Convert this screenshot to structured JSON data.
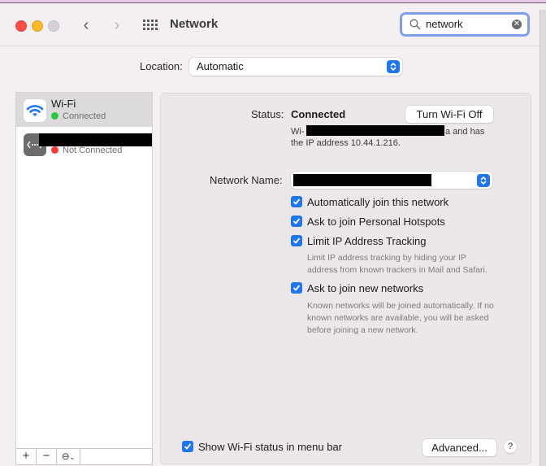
{
  "window": {
    "title": "Network",
    "search": {
      "value": "network",
      "placeholder": "Search"
    }
  },
  "location": {
    "label": "Location:",
    "value": "Automatic"
  },
  "sidebar": {
    "services": [
      {
        "name": "Wi-Fi",
        "status": "Connected",
        "status_color": "#27c93f",
        "icon": "wifi-icon",
        "selected": true
      },
      {
        "name": "[redacted]",
        "status": "Not Connected",
        "status_color": "#fe3b30",
        "icon": "ethernet-dots-icon",
        "selected": false
      }
    ],
    "footer": {
      "add": "+",
      "remove": "−",
      "action": "⊖"
    }
  },
  "detail": {
    "status_label": "Status:",
    "status_value": "Connected",
    "turn_off_button": "Turn Wi-Fi Off",
    "status_desc_prefix": "Wi-",
    "status_desc_suffix": "a and has",
    "status_desc_line2": "the IP address 10.44.1.216.",
    "network_name_label": "Network Name:",
    "checkboxes": [
      {
        "label": "Automatically join this network",
        "checked": true
      },
      {
        "label": "Ask to join Personal Hotspots",
        "checked": true
      },
      {
        "label": "Limit IP Address Tracking",
        "checked": true,
        "help": "Limit IP address tracking by hiding your IP address from known trackers in Mail and Safari."
      },
      {
        "label": "Ask to join new networks",
        "checked": true,
        "help": "Known networks will be joined automatically. If no known networks are available, you will be asked before joining a new network."
      }
    ],
    "show_status_menu_bar": {
      "label": "Show Wi-Fi status in menu bar",
      "checked": true
    },
    "advanced_button": "Advanced...",
    "help_button": "?"
  },
  "colors": {
    "accent": "#1e76f4",
    "focus_ring": "#7f9ef2"
  }
}
